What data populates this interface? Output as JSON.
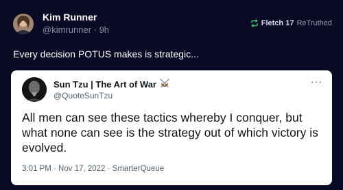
{
  "post": {
    "author_name": "Kim Runner",
    "handle": "@kimrunner",
    "separator": " · ",
    "time": "9h",
    "retruth_user": "Fletch 17",
    "retruth_label": "ReTruthed",
    "text": "Every decision POTUS makes is strategic..."
  },
  "quote": {
    "name": "Sun Tzu | The Art of War",
    "badge_icon": "crossed-swords-icon",
    "handle": "@QuoteSunTzu",
    "text": "All men can see these tactics whereby I conquer, but what none can see is the strategy out of which victory is evolved.",
    "meta": "3:01 PM · Nov 17, 2022 · SmarterQueue",
    "more": "···"
  },
  "colors": {
    "background": "#0b0a26",
    "accent_green": "#3ec46d",
    "card": "#ffffff",
    "muted": "#8e8da8"
  }
}
